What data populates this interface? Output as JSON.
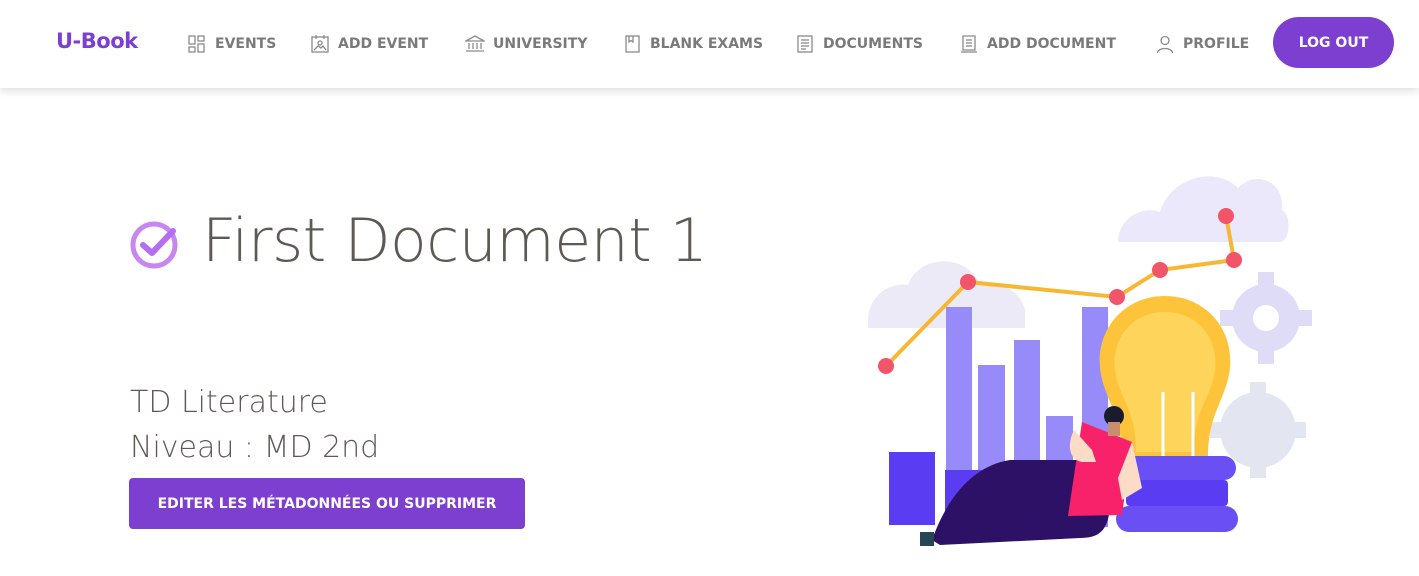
{
  "brand": {
    "name": "U-Book",
    "color": "#7d3fd0"
  },
  "nav": {
    "items": [
      {
        "label": "EVENTS",
        "icon": "dashboard-icon"
      },
      {
        "label": "ADD EVENT",
        "icon": "calendar-image-icon"
      },
      {
        "label": "UNIVERSITY",
        "icon": "university-icon"
      },
      {
        "label": "BLANK EXAMS",
        "icon": "book-icon"
      },
      {
        "label": "DOCUMENTS",
        "icon": "document-icon"
      },
      {
        "label": "ADD DOCUMENT",
        "icon": "add-document-icon"
      },
      {
        "label": "PROFILE",
        "icon": "user-icon"
      }
    ],
    "logout_label": "LOG OUT"
  },
  "document": {
    "title": "First Document 1",
    "subject": "TD Literature",
    "level": "Niveau : MD 2nd",
    "edit_label": "EDITER LES MÉTADONNÉES OU SUPPRIMER"
  },
  "colors": {
    "accent": "#7d3fcf",
    "check": "#c887f0",
    "bulb": "#fdc33b",
    "bar_light": "#968bf9",
    "bar_dark": "#5a3df2",
    "dot": "#f2546a",
    "cloud": "#e9e6fb"
  }
}
